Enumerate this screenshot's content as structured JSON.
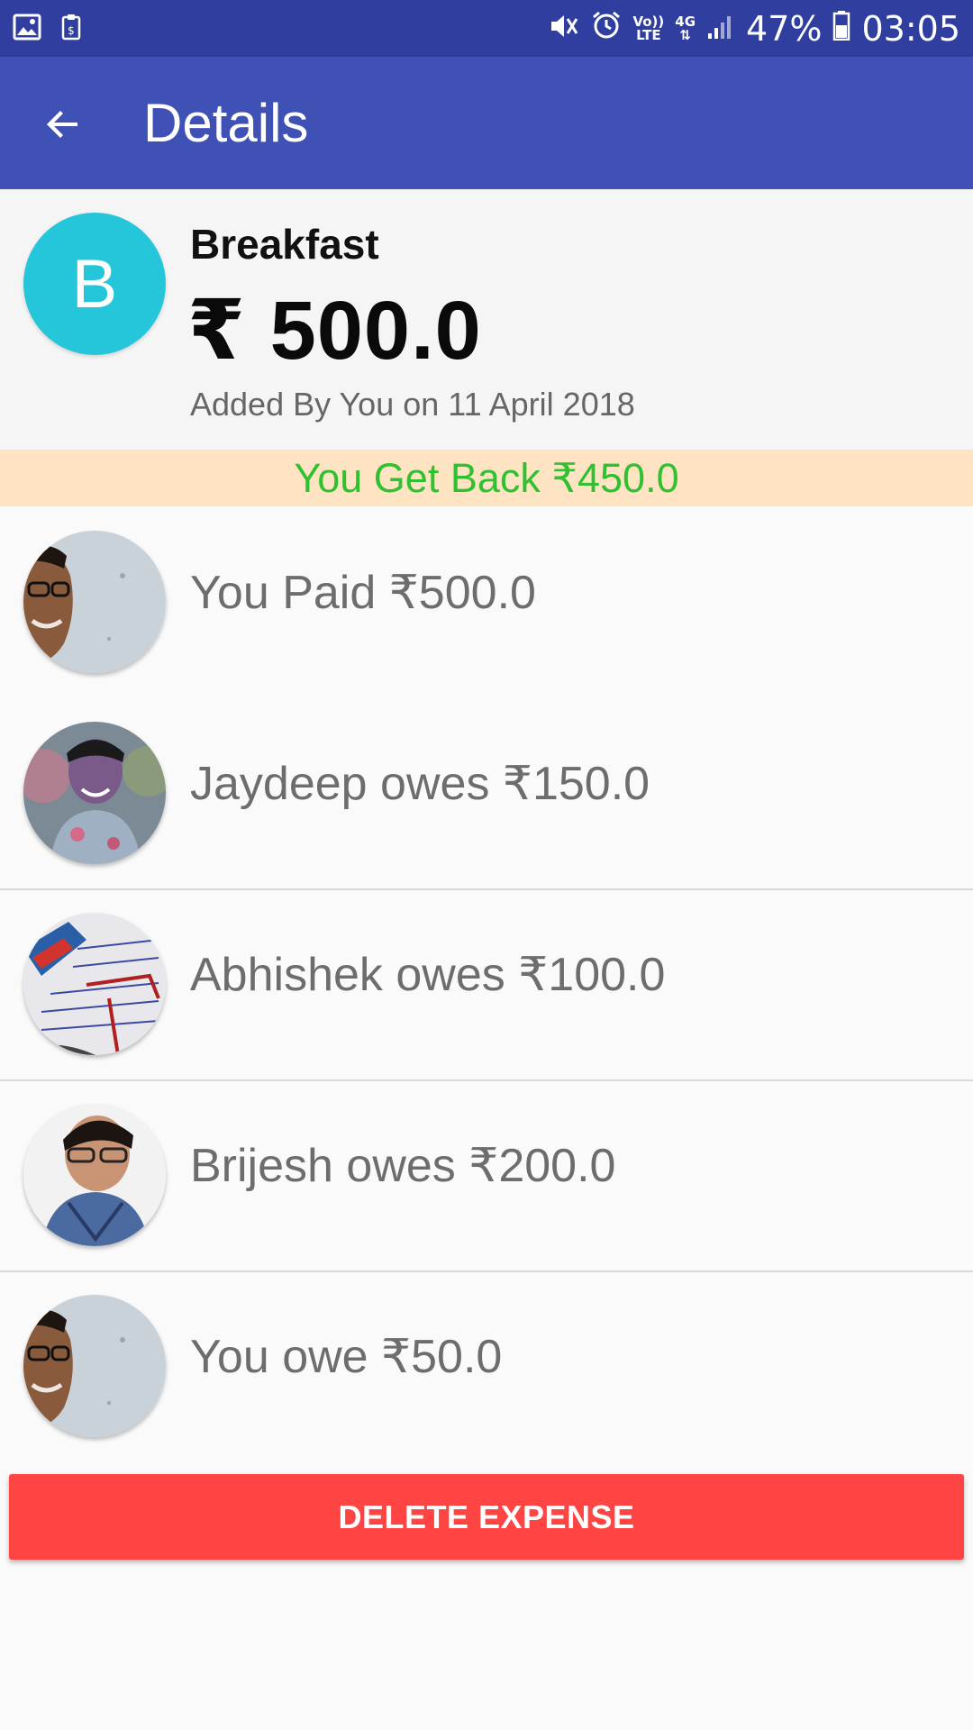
{
  "status_bar": {
    "icons": [
      "gallery-icon",
      "clipboard-icon",
      "mute-icon",
      "alarm-icon",
      "volte-icon",
      "4g-data-icon",
      "signal-icon",
      "battery-icon"
    ],
    "volte_label_top": "Vo))",
    "volte_label_bottom": "LTE",
    "network_label": "4G",
    "battery": "47%",
    "time": "03:05"
  },
  "app_bar": {
    "title": "Details",
    "back_icon": "arrow-back-icon"
  },
  "expense": {
    "avatar_letter": "B",
    "avatar_color": "#26c6da",
    "title": "Breakfast",
    "amount": "₹ 500.0",
    "meta": "Added By You on 11 April 2018"
  },
  "banner": {
    "text": "You Get Back ₹450.0",
    "background": "#ffe4c4",
    "color": "#2fc12f"
  },
  "entries": [
    {
      "text": "You Paid ₹500.0",
      "avatar": "user-photo-you"
    },
    {
      "text": "Jaydeep owes ₹150.0",
      "avatar": "user-photo-jaydeep"
    },
    {
      "text": "Abhishek owes ₹100.0",
      "avatar": "user-photo-abhishek"
    },
    {
      "text": "Brijesh owes ₹200.0",
      "avatar": "user-photo-brijesh"
    },
    {
      "text": "You owe ₹50.0",
      "avatar": "user-photo-you"
    }
  ],
  "actions": {
    "delete_label": "DELETE EXPENSE",
    "delete_color": "#ff4444"
  },
  "colors": {
    "status_bar": "#303f9f",
    "app_bar": "#3f51b5"
  }
}
